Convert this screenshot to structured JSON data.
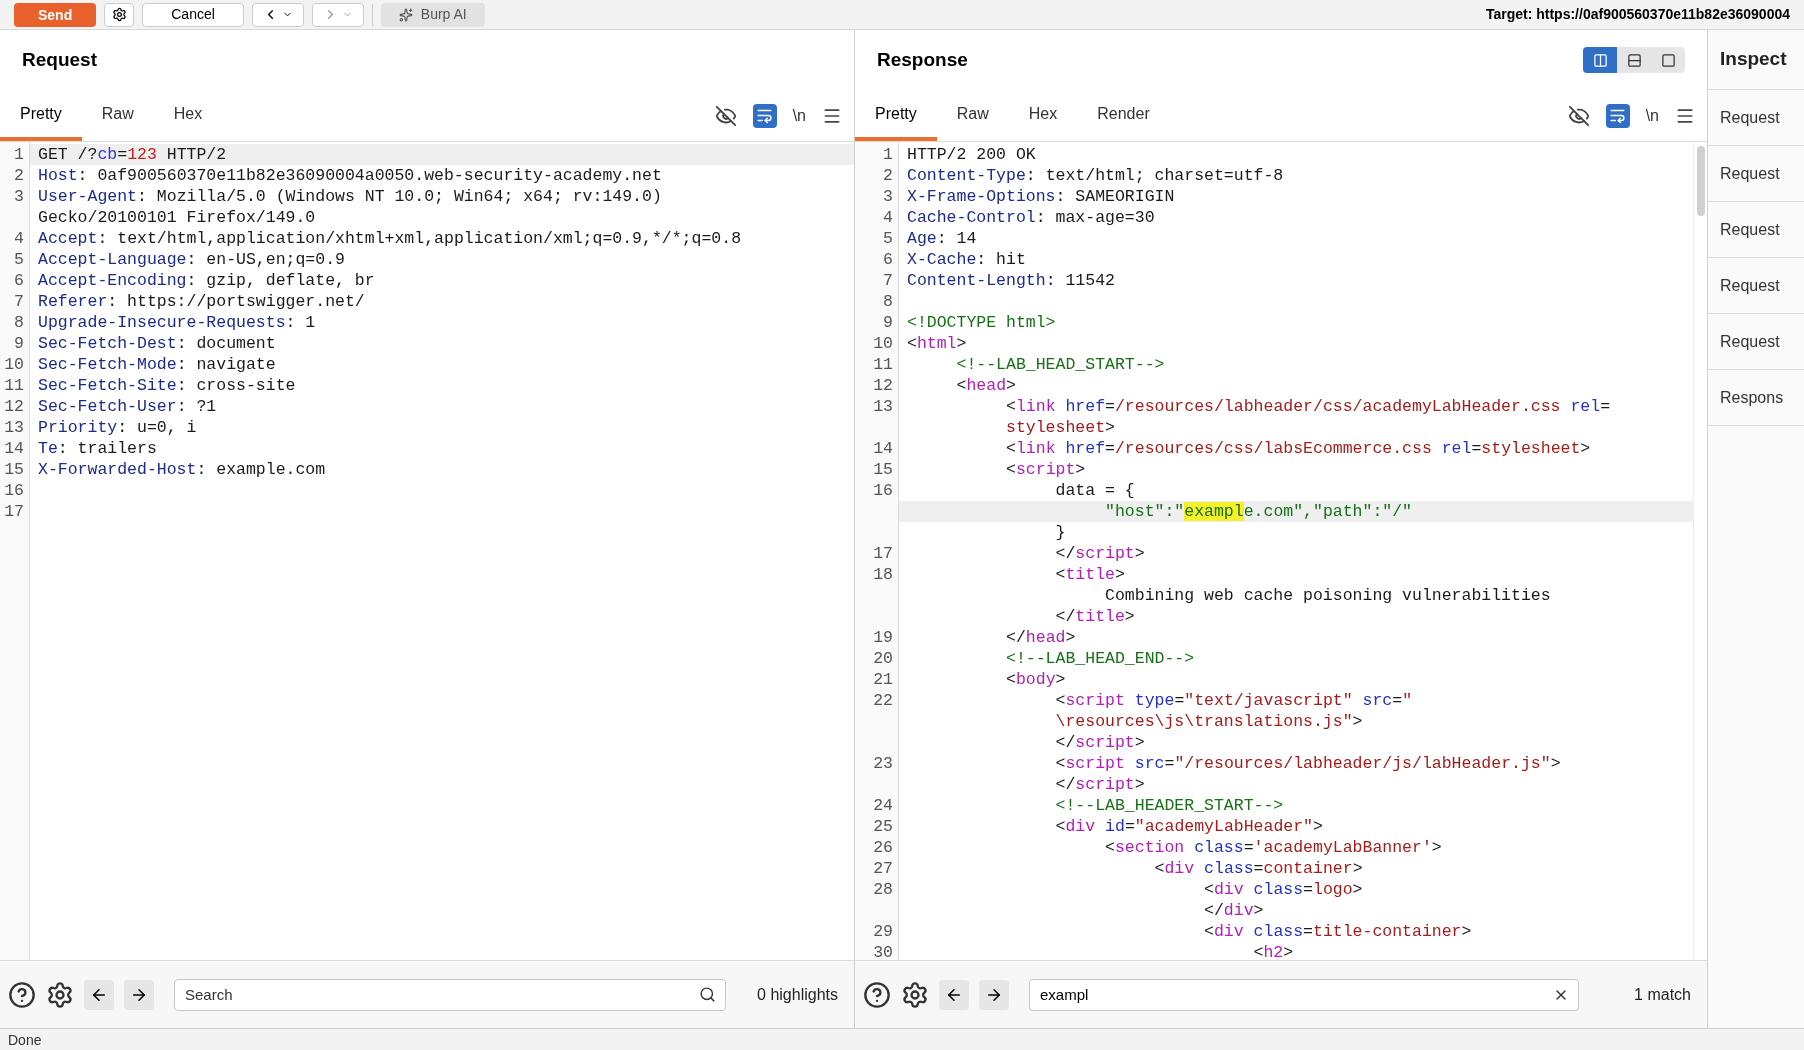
{
  "toolbar": {
    "send": "Send",
    "cancel": "Cancel",
    "burp_ai": "Burp AI",
    "target": "Target: https://0af900560370e11b82e36090004"
  },
  "request": {
    "title": "Request",
    "tabs": [
      {
        "label": "Pretty",
        "selected": true
      },
      {
        "label": "Raw",
        "selected": false
      },
      {
        "label": "Hex",
        "selected": false
      }
    ],
    "newline_toggle": "\\n",
    "wrap_on": true,
    "lines": [
      {
        "n": "1",
        "current": true,
        "tokens": [
          {
            "kind": "plain",
            "text": "GET /?"
          },
          {
            "kind": "param",
            "text": "cb"
          },
          {
            "kind": "plain",
            "text": "="
          },
          {
            "kind": "number",
            "text": "123"
          },
          {
            "kind": "plain",
            "text": " HTTP/2"
          }
        ]
      },
      {
        "n": "2",
        "tokens": [
          {
            "kind": "header",
            "text": "Host"
          },
          {
            "kind": "plain",
            "text": ": 0af900560370e11b82e36090004a0050.web-security-academy.net"
          }
        ]
      },
      {
        "n": "3",
        "tokens": [
          {
            "kind": "header",
            "text": "User-Agent"
          },
          {
            "kind": "plain",
            "text": ": Mozilla/5.0 (Windows NT 10.0; Win64; x64; rv:149.0)"
          }
        ]
      },
      {
        "tokens": [
          {
            "kind": "plain",
            "text": "Gecko/20100101 Firefox/149.0"
          }
        ]
      },
      {
        "n": "4",
        "tokens": [
          {
            "kind": "header",
            "text": "Accept"
          },
          {
            "kind": "plain",
            "text": ": text/html,application/xhtml+xml,application/xml;q=0.9,*/*;q=0.8"
          }
        ]
      },
      {
        "n": "5",
        "tokens": [
          {
            "kind": "header",
            "text": "Accept-Language"
          },
          {
            "kind": "plain",
            "text": ": en-US,en;q=0.9"
          }
        ]
      },
      {
        "n": "6",
        "tokens": [
          {
            "kind": "header",
            "text": "Accept-Encoding"
          },
          {
            "kind": "plain",
            "text": ": gzip, deflate, br"
          }
        ]
      },
      {
        "n": "7",
        "tokens": [
          {
            "kind": "header",
            "text": "Referer"
          },
          {
            "kind": "plain",
            "text": ": https://portswigger.net/"
          }
        ]
      },
      {
        "n": "8",
        "tokens": [
          {
            "kind": "header",
            "text": "Upgrade-Insecure-Requests"
          },
          {
            "kind": "plain",
            "text": ": 1"
          }
        ]
      },
      {
        "n": "9",
        "tokens": [
          {
            "kind": "header",
            "text": "Sec-Fetch-Dest"
          },
          {
            "kind": "plain",
            "text": ": document"
          }
        ]
      },
      {
        "n": "10",
        "tokens": [
          {
            "kind": "header",
            "text": "Sec-Fetch-Mode"
          },
          {
            "kind": "plain",
            "text": ": navigate"
          }
        ]
      },
      {
        "n": "11",
        "tokens": [
          {
            "kind": "header",
            "text": "Sec-Fetch-Site"
          },
          {
            "kind": "plain",
            "text": ": cross-site"
          }
        ]
      },
      {
        "n": "12",
        "tokens": [
          {
            "kind": "header",
            "text": "Sec-Fetch-User"
          },
          {
            "kind": "plain",
            "text": ": ?1"
          }
        ]
      },
      {
        "n": "13",
        "tokens": [
          {
            "kind": "header",
            "text": "Priority"
          },
          {
            "kind": "plain",
            "text": ": u=0, i"
          }
        ]
      },
      {
        "n": "14",
        "tokens": [
          {
            "kind": "header",
            "text": "Te"
          },
          {
            "kind": "plain",
            "text": ": trailers"
          }
        ]
      },
      {
        "n": "15",
        "tokens": [
          {
            "kind": "header",
            "text": "X-Forwarded-Host"
          },
          {
            "kind": "plain",
            "text": ": example.com"
          }
        ]
      },
      {
        "n": "16"
      },
      {
        "n": "17"
      }
    ],
    "search": {
      "placeholder": "Search",
      "result": "0 highlights"
    }
  },
  "response": {
    "title": "Response",
    "layout_buttons": [
      {
        "selected": true
      },
      {
        "selected": false
      },
      {
        "selected": false
      }
    ],
    "tabs": [
      {
        "label": "Pretty",
        "selected": true
      },
      {
        "label": "Raw",
        "selected": false
      },
      {
        "label": "Hex",
        "selected": false
      },
      {
        "label": "Render",
        "selected": false
      }
    ],
    "newline_toggle": "\\n",
    "wrap_on": true,
    "lines": [
      {
        "n": "1",
        "tokens": [
          {
            "kind": "plain",
            "text": "HTTP/2 200 OK"
          }
        ]
      },
      {
        "n": "2",
        "tokens": [
          {
            "kind": "header",
            "text": "Content-Type"
          },
          {
            "kind": "plain",
            "text": ": text/html; charset=utf-8"
          }
        ]
      },
      {
        "n": "3",
        "tokens": [
          {
            "kind": "header",
            "text": "X-Frame-Options"
          },
          {
            "kind": "plain",
            "text": ": SAMEORIGIN"
          }
        ]
      },
      {
        "n": "4",
        "tokens": [
          {
            "kind": "header",
            "text": "Cache-Control"
          },
          {
            "kind": "plain",
            "text": ": max-age=30"
          }
        ]
      },
      {
        "n": "5",
        "tokens": [
          {
            "kind": "header",
            "text": "Age"
          },
          {
            "kind": "plain",
            "text": ": 14"
          }
        ]
      },
      {
        "n": "6",
        "tokens": [
          {
            "kind": "header",
            "text": "X-Cache"
          },
          {
            "kind": "plain",
            "text": ": hit"
          }
        ]
      },
      {
        "n": "7",
        "tokens": [
          {
            "kind": "header",
            "text": "Content-Length"
          },
          {
            "kind": "plain",
            "text": ": 11542"
          }
        ]
      },
      {
        "n": "8"
      },
      {
        "n": "9",
        "tokens": [
          {
            "kind": "comment",
            "text": "<!DOCTYPE html>"
          }
        ]
      },
      {
        "n": "10",
        "tokens": [
          {
            "kind": "plain",
            "text": "<"
          },
          {
            "kind": "tag",
            "text": "html"
          },
          {
            "kind": "plain",
            "text": ">"
          }
        ]
      },
      {
        "n": "11",
        "tokens": [
          {
            "kind": "comment",
            "text": "     <!--LAB_HEAD_START-->"
          }
        ]
      },
      {
        "n": "12",
        "tokens": [
          {
            "kind": "plain",
            "text": "     <"
          },
          {
            "kind": "tag",
            "text": "head"
          },
          {
            "kind": "plain",
            "text": ">"
          }
        ]
      },
      {
        "n": "13",
        "tokens": [
          {
            "kind": "plain",
            "text": "          <"
          },
          {
            "kind": "tag",
            "text": "link"
          },
          {
            "kind": "attr",
            "text": " href"
          },
          {
            "kind": "plain",
            "text": "="
          },
          {
            "kind": "value",
            "text": "/resources/labheader/css/academyLabHeader.css"
          },
          {
            "kind": "attr",
            "text": " rel"
          },
          {
            "kind": "plain",
            "text": "="
          }
        ]
      },
      {
        "tokens": [
          {
            "kind": "value",
            "text": "          stylesheet"
          },
          {
            "kind": "plain",
            "text": ">"
          }
        ]
      },
      {
        "n": "14",
        "tokens": [
          {
            "kind": "plain",
            "text": "          <"
          },
          {
            "kind": "tag",
            "text": "link"
          },
          {
            "kind": "attr",
            "text": " href"
          },
          {
            "kind": "plain",
            "text": "="
          },
          {
            "kind": "value",
            "text": "/resources/css/labsEcommerce.css"
          },
          {
            "kind": "attr",
            "text": " rel"
          },
          {
            "kind": "plain",
            "text": "="
          },
          {
            "kind": "value",
            "text": "stylesheet"
          },
          {
            "kind": "plain",
            "text": ">"
          }
        ]
      },
      {
        "n": "15",
        "tokens": [
          {
            "kind": "plain",
            "text": "          <"
          },
          {
            "kind": "tag",
            "text": "script"
          },
          {
            "kind": "plain",
            "text": ">"
          }
        ]
      },
      {
        "n": "16",
        "tokens": [
          {
            "kind": "plain",
            "text": "               data = {"
          }
        ]
      },
      {
        "current": true,
        "tokens": [
          {
            "kind": "string",
            "text": "                    \"host\":\""
          },
          {
            "kind": "match",
            "text": "exampl"
          },
          {
            "kind": "string",
            "text": "e.com\",\"path\":\"/\""
          }
        ]
      },
      {
        "tokens": [
          {
            "kind": "plain",
            "text": "               }"
          }
        ]
      },
      {
        "n": "17",
        "tokens": [
          {
            "kind": "plain",
            "text": "               </"
          },
          {
            "kind": "tag",
            "text": "script"
          },
          {
            "kind": "plain",
            "text": ">"
          }
        ]
      },
      {
        "n": "18",
        "tokens": [
          {
            "kind": "plain",
            "text": "               <"
          },
          {
            "kind": "tag",
            "text": "title"
          },
          {
            "kind": "plain",
            "text": ">"
          }
        ]
      },
      {
        "tokens": [
          {
            "kind": "plain",
            "text": "                    Combining web cache poisoning vulnerabilities"
          }
        ]
      },
      {
        "tokens": [
          {
            "kind": "plain",
            "text": "               </"
          },
          {
            "kind": "tag",
            "text": "title"
          },
          {
            "kind": "plain",
            "text": ">"
          }
        ]
      },
      {
        "n": "19",
        "tokens": [
          {
            "kind": "plain",
            "text": "          </"
          },
          {
            "kind": "tag",
            "text": "head"
          },
          {
            "kind": "plain",
            "text": ">"
          }
        ]
      },
      {
        "n": "20",
        "tokens": [
          {
            "kind": "comment",
            "text": "          <!--LAB_HEAD_END-->"
          }
        ]
      },
      {
        "n": "21",
        "tokens": [
          {
            "kind": "plain",
            "text": "          <"
          },
          {
            "kind": "tag",
            "text": "body"
          },
          {
            "kind": "plain",
            "text": ">"
          }
        ]
      },
      {
        "n": "22",
        "tokens": [
          {
            "kind": "plain",
            "text": "               <"
          },
          {
            "kind": "tag",
            "text": "script"
          },
          {
            "kind": "attr",
            "text": " type"
          },
          {
            "kind": "plain",
            "text": "="
          },
          {
            "kind": "value",
            "text": "\"text/javascript\""
          },
          {
            "kind": "attr",
            "text": " src"
          },
          {
            "kind": "plain",
            "text": "="
          },
          {
            "kind": "value",
            "text": "\""
          }
        ]
      },
      {
        "tokens": [
          {
            "kind": "value",
            "text": "               \\resources\\js\\translations.js\""
          },
          {
            "kind": "plain",
            "text": ">"
          }
        ]
      },
      {
        "tokens": [
          {
            "kind": "plain",
            "text": "               </"
          },
          {
            "kind": "tag",
            "text": "script"
          },
          {
            "kind": "plain",
            "text": ">"
          }
        ]
      },
      {
        "n": "23",
        "tokens": [
          {
            "kind": "plain",
            "text": "               <"
          },
          {
            "kind": "tag",
            "text": "script"
          },
          {
            "kind": "attr",
            "text": " src"
          },
          {
            "kind": "plain",
            "text": "="
          },
          {
            "kind": "value",
            "text": "\"/resources/labheader/js/labHeader.js\""
          },
          {
            "kind": "plain",
            "text": ">"
          }
        ]
      },
      {
        "tokens": [
          {
            "kind": "plain",
            "text": "               </"
          },
          {
            "kind": "tag",
            "text": "script"
          },
          {
            "kind": "plain",
            "text": ">"
          }
        ]
      },
      {
        "n": "24",
        "tokens": [
          {
            "kind": "comment",
            "text": "               <!--LAB_HEADER_START-->"
          }
        ]
      },
      {
        "n": "25",
        "tokens": [
          {
            "kind": "plain",
            "text": "               <"
          },
          {
            "kind": "tag",
            "text": "div"
          },
          {
            "kind": "attr",
            "text": " id"
          },
          {
            "kind": "plain",
            "text": "="
          },
          {
            "kind": "value",
            "text": "\"academyLabHeader\""
          },
          {
            "kind": "plain",
            "text": ">"
          }
        ]
      },
      {
        "n": "26",
        "tokens": [
          {
            "kind": "plain",
            "text": "                    <"
          },
          {
            "kind": "tag",
            "text": "section"
          },
          {
            "kind": "attr",
            "text": " class"
          },
          {
            "kind": "plain",
            "text": "="
          },
          {
            "kind": "value",
            "text": "'academyLabBanner'"
          },
          {
            "kind": "plain",
            "text": ">"
          }
        ]
      },
      {
        "n": "27",
        "tokens": [
          {
            "kind": "plain",
            "text": "                         <"
          },
          {
            "kind": "tag",
            "text": "div"
          },
          {
            "kind": "attr",
            "text": " class"
          },
          {
            "kind": "plain",
            "text": "="
          },
          {
            "kind": "value",
            "text": "container"
          },
          {
            "kind": "plain",
            "text": ">"
          }
        ]
      },
      {
        "n": "28",
        "tokens": [
          {
            "kind": "plain",
            "text": "                              <"
          },
          {
            "kind": "tag",
            "text": "div"
          },
          {
            "kind": "attr",
            "text": " class"
          },
          {
            "kind": "plain",
            "text": "="
          },
          {
            "kind": "value",
            "text": "logo"
          },
          {
            "kind": "plain",
            "text": ">"
          }
        ]
      },
      {
        "tokens": [
          {
            "kind": "plain",
            "text": "                              </"
          },
          {
            "kind": "tag",
            "text": "div"
          },
          {
            "kind": "plain",
            "text": ">"
          }
        ]
      },
      {
        "n": "29",
        "tokens": [
          {
            "kind": "plain",
            "text": "                              <"
          },
          {
            "kind": "tag",
            "text": "div"
          },
          {
            "kind": "attr",
            "text": " class"
          },
          {
            "kind": "plain",
            "text": "="
          },
          {
            "kind": "value",
            "text": "title-container"
          },
          {
            "kind": "plain",
            "text": ">"
          }
        ]
      },
      {
        "n": "30",
        "tokens": [
          {
            "kind": "plain",
            "text": "                                   <"
          },
          {
            "kind": "tag",
            "text": "h2"
          },
          {
            "kind": "plain",
            "text": ">"
          }
        ]
      }
    ],
    "search": {
      "value": "exampl",
      "result": "1 match"
    }
  },
  "inspector": {
    "title": "Inspect",
    "rows": [
      "Request",
      "Request",
      "Request",
      "Request",
      "Request",
      "Respons"
    ]
  },
  "status_bar": "Done"
}
